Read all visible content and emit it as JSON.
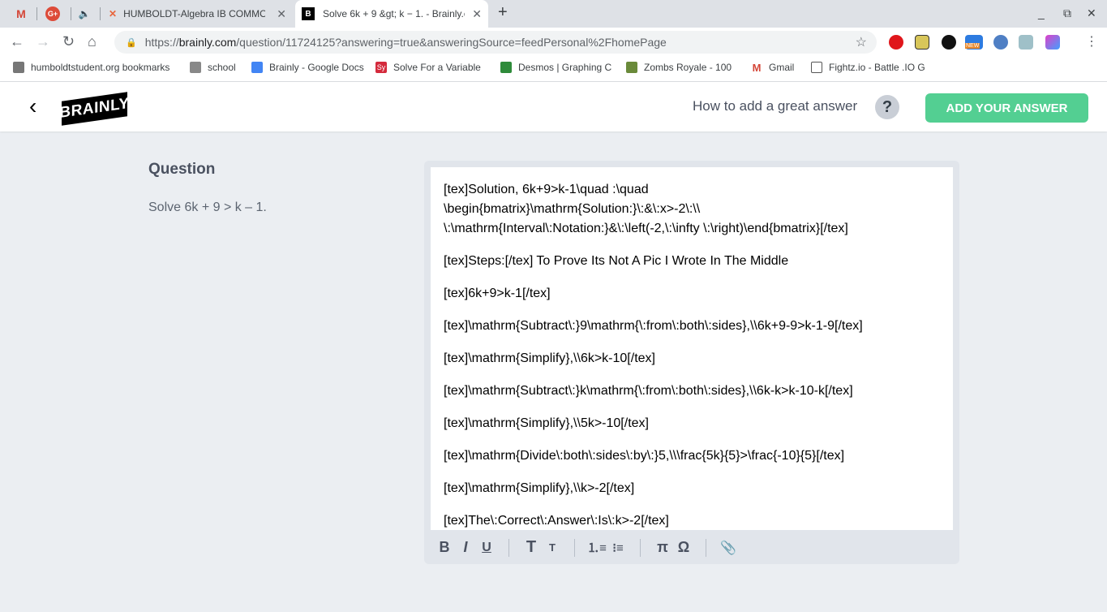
{
  "browser": {
    "tabs": [
      {
        "label": "HUMBOLDT-Algebra IB COMMON"
      },
      {
        "label": "Solve 6k + 9 &gt; k − 1. - Brainly.c"
      }
    ],
    "new_tab": "+",
    "url_prefix": "https://",
    "url_domain": "brainly.com",
    "url_path": "/question/11724125?answering=true&answeringSource=feedPersonal%2FhomePage",
    "bookmarks": [
      {
        "label": "humboldtstudent.org bookmarks",
        "icon": "bookmark-folder-icon"
      },
      {
        "label": "school",
        "icon": "folder-icon"
      },
      {
        "label": "Brainly - Google Docs",
        "icon": "docs-icon"
      },
      {
        "label": "Solve For a Variable",
        "icon": "sy-icon",
        "badge": "Sy"
      },
      {
        "label": "Desmos | Graphing C",
        "icon": "desmos-icon"
      },
      {
        "label": "Zombs Royale - 100",
        "icon": "zombs-icon"
      },
      {
        "label": "Gmail",
        "icon": "gmail-icon"
      },
      {
        "label": "Fightz.io - Battle .IO G",
        "icon": "page-icon"
      }
    ],
    "ext_new_badge": "NEW"
  },
  "header": {
    "logo": "BRAINLY",
    "help_text": "How to add a great answer",
    "help_icon": "?",
    "add_answer": "ADD YOUR ANSWER"
  },
  "question": {
    "title": "Question",
    "text": "Solve 6k + 9 > k – 1."
  },
  "answer": {
    "first_lines": [
      "[tex]Solution, 6k+9>k-1\\quad :\\quad",
      "\\begin{bmatrix}\\mathrm{Solution:}\\:&\\:x>-2\\:\\\\",
      "\\:\\mathrm{Interval\\:Notation:}&\\:\\left(-2,\\:\\infty \\:\\right)\\end{bmatrix}[/tex]"
    ],
    "paragraphs": [
      "[tex]Steps:[/tex]  To Prove Its Not A Pic I Wrote In The Middle",
      "[tex]6k+9>k-1[/tex]",
      "[tex]\\mathrm{Subtract\\:}9\\mathrm{\\:from\\:both\\:sides},\\\\6k+9-9>k-1-9[/tex]",
      "[tex]\\mathrm{Simplify},\\\\6k>k-10[/tex]",
      "[tex]\\mathrm{Subtract\\:}k\\mathrm{\\:from\\:both\\:sides},\\\\6k-k>k-10-k[/tex]",
      "[tex]\\mathrm{Simplify},\\\\5k>-10[/tex]",
      "[tex]\\mathrm{Divide\\:both\\:sides\\:by\\:}5,\\\\\\frac{5k}{5}>\\frac{-10}{5}[/tex]",
      "[tex]\\mathrm{Simplify},\\\\k>-2[/tex]",
      "[tex]The\\:Correct\\:Answer\\:Is\\:k>-2[/tex]"
    ],
    "toolbar": {
      "bold": "B",
      "italic": "I",
      "underline": "U",
      "heading": "T",
      "small": "T",
      "pi": "π",
      "omega": "Ω"
    }
  }
}
